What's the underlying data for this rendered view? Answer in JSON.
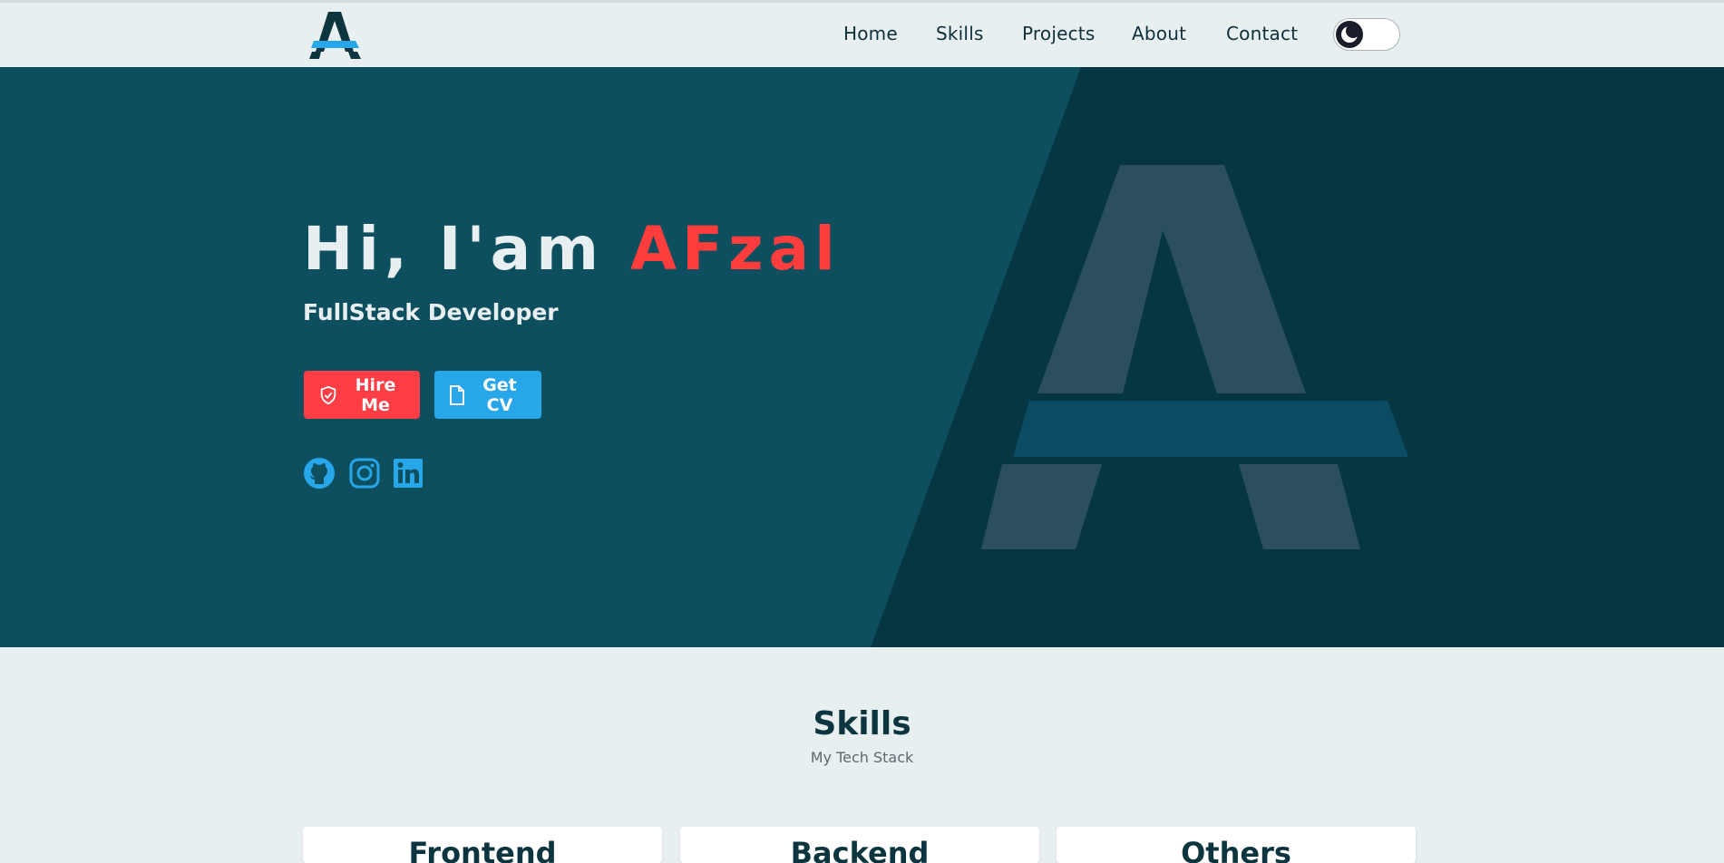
{
  "colors": {
    "accent_red": "#ff3d3d",
    "accent_blue": "#27a6ea",
    "hero_bg": "#0d4e5f",
    "hero_bg_dark": "#073643",
    "page_bg": "#e8eff1",
    "heading": "#0c3540"
  },
  "nav": {
    "logo_letter": "A",
    "links": [
      "Home",
      "Skills",
      "Projects",
      "About",
      "Contact"
    ],
    "theme_toggle_icon": "moon-icon"
  },
  "hero": {
    "title_prefix": "Hi, I'am ",
    "title_name": "AFzal",
    "subtitle": "FullStack Developer",
    "hire_label": "Hire Me",
    "hire_icon": "shield-check-icon",
    "cv_label": "Get CV",
    "cv_icon": "file-icon",
    "social_icons": [
      "github-icon",
      "instagram-icon",
      "linkedin-icon"
    ]
  },
  "skills": {
    "title": "Skills",
    "subtitle": "My Tech Stack",
    "cards": [
      "Frontend",
      "Backend",
      "Others"
    ]
  }
}
